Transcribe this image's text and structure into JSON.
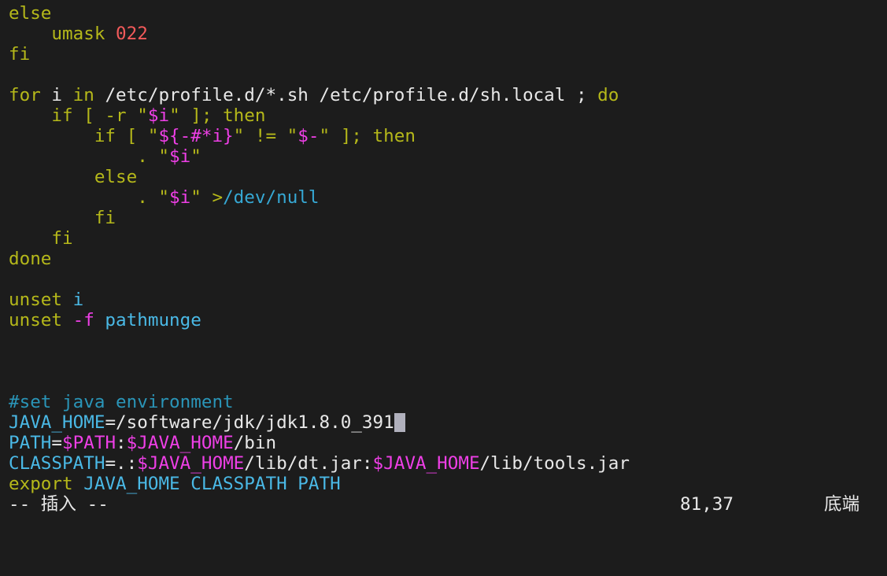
{
  "editor": {
    "lines": [
      [
        {
          "t": "else",
          "c": "kw"
        }
      ],
      [
        {
          "t": "    umask ",
          "c": "kw"
        },
        {
          "t": "022",
          "c": "num"
        }
      ],
      [
        {
          "t": "fi",
          "c": "kw"
        }
      ],
      [],
      [
        {
          "t": "for",
          "c": "kw"
        },
        {
          "t": " i ",
          "c": "plain"
        },
        {
          "t": "in",
          "c": "kw"
        },
        {
          "t": " /etc/profile.d/*.sh /etc/profile.d/sh.local ; ",
          "c": "plain"
        },
        {
          "t": "do",
          "c": "kw"
        }
      ],
      [
        {
          "t": "    if [ -r \"",
          "c": "kw"
        },
        {
          "t": "$i",
          "c": "var"
        },
        {
          "t": "\" ]; then",
          "c": "kw"
        }
      ],
      [
        {
          "t": "        if [ \"",
          "c": "kw"
        },
        {
          "t": "${-#*i}",
          "c": "var"
        },
        {
          "t": "\" != \"",
          "c": "kw"
        },
        {
          "t": "$-",
          "c": "var"
        },
        {
          "t": "\" ]; then",
          "c": "kw"
        }
      ],
      [
        {
          "t": "            . \"",
          "c": "kw"
        },
        {
          "t": "$i",
          "c": "var"
        },
        {
          "t": "\"",
          "c": "kw"
        }
      ],
      [
        {
          "t": "        else",
          "c": "kw"
        }
      ],
      [
        {
          "t": "            . \"",
          "c": "kw"
        },
        {
          "t": "$i",
          "c": "var"
        },
        {
          "t": "\" >",
          "c": "kw"
        },
        {
          "t": "/dev/null",
          "c": "cyan"
        }
      ],
      [
        {
          "t": "        fi",
          "c": "kw"
        }
      ],
      [
        {
          "t": "    fi",
          "c": "kw"
        }
      ],
      [
        {
          "t": "done",
          "c": "kw"
        }
      ],
      [],
      [
        {
          "t": "unset",
          "c": "kw"
        },
        {
          "t": " i",
          "c": "ident"
        }
      ],
      [
        {
          "t": "unset",
          "c": "kw"
        },
        {
          "t": " -f",
          "c": "var"
        },
        {
          "t": " pathmunge",
          "c": "ident"
        }
      ],
      [],
      [],
      [],
      [
        {
          "t": "#set java environment",
          "c": "cmt"
        }
      ],
      [
        {
          "t": "JAVA_HOME",
          "c": "ident"
        },
        {
          "t": "=/software/jdk/jdk1.8.0_391",
          "c": "plain"
        },
        {
          "cursor": true
        }
      ],
      [
        {
          "t": "PATH",
          "c": "ident"
        },
        {
          "t": "=",
          "c": "plain"
        },
        {
          "t": "$PATH",
          "c": "var"
        },
        {
          "t": ":",
          "c": "plain"
        },
        {
          "t": "$JAVA_HOME",
          "c": "var"
        },
        {
          "t": "/bin",
          "c": "plain"
        }
      ],
      [
        {
          "t": "CLASSPATH",
          "c": "ident"
        },
        {
          "t": "=.:",
          "c": "plain"
        },
        {
          "t": "$JAVA_HOME",
          "c": "var"
        },
        {
          "t": "/lib/dt.jar:",
          "c": "plain"
        },
        {
          "t": "$JAVA_HOME",
          "c": "var"
        },
        {
          "t": "/lib/tools.jar",
          "c": "plain"
        }
      ],
      [
        {
          "t": "export",
          "c": "kw"
        },
        {
          "t": " JAVA_HOME CLASSPATH PATH",
          "c": "ident"
        }
      ]
    ]
  },
  "statusline": {
    "mode": "-- 插入 --",
    "position": "81,37",
    "scroll": "底端"
  },
  "colors": {
    "background": "#1c1c1c",
    "keyword": "#b5b81a",
    "number": "#f25a5a",
    "variable": "#ee3fe6",
    "identifier": "#4ab9e6",
    "comment": "#2a95b8"
  }
}
